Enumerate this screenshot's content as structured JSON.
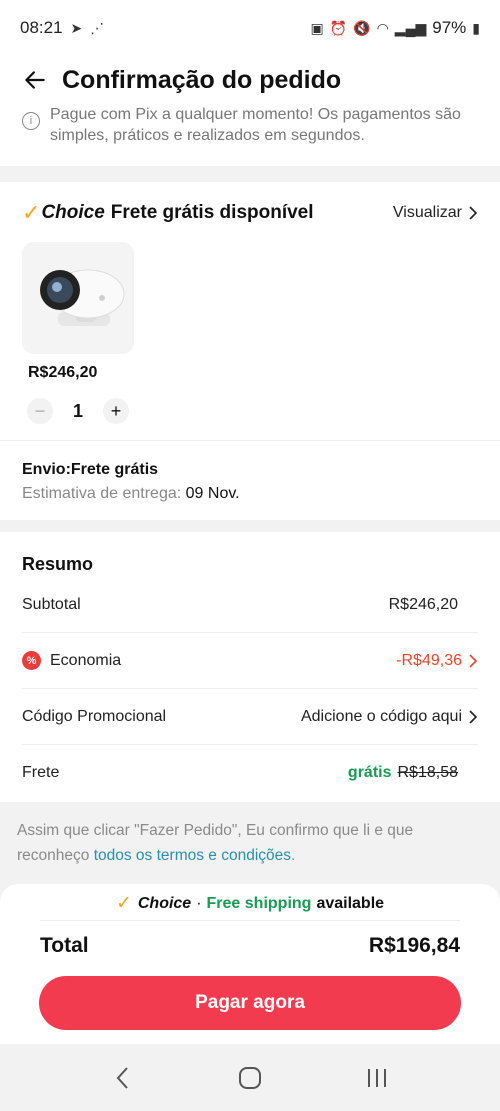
{
  "status_bar": {
    "time": "08:21",
    "battery": "97%"
  },
  "header": {
    "title": "Confirmação do pedido"
  },
  "pix_note": {
    "text": "Pague com Pix a qualquer momento! Os pagamentos são simples, práticos e realizados em segundos."
  },
  "product_card": {
    "choice_label": "Choice",
    "title": "Frete grátis disponível",
    "view_label": "Visualizar",
    "price": "R$246,20",
    "quantity": "1",
    "shipping_title": "Envio:Frete grátis",
    "estimate_label": "Estimativa de entrega:",
    "estimate_date": "09 Nov."
  },
  "summary": {
    "title": "Resumo",
    "subtotal_label": "Subtotal",
    "subtotal_value": "R$246,20",
    "economy_label": "Economia",
    "economy_value": "-R$49,36",
    "promo_label": "Código Promocional",
    "promo_action": "Adicione o código aqui",
    "freight_label": "Frete",
    "freight_free": "grátis",
    "freight_old": "R$18,58"
  },
  "terms": {
    "text": "Assim que clicar \"Fazer Pedido\", Eu confirmo que li e que reconheço ",
    "link": "todos os termos e condições",
    "end": "."
  },
  "bottom": {
    "choice_label": "Choice",
    "separator": "·",
    "free_shipping": "Free shipping",
    "available": "available",
    "total_label": "Total",
    "total_value": "R$196,84",
    "pay_button": "Pagar agora"
  },
  "colors": {
    "accent": "#f23b4f",
    "green": "#1a9b54",
    "red": "#e8452c",
    "choice_check": "#f5a623",
    "link": "#2a8fb0"
  }
}
